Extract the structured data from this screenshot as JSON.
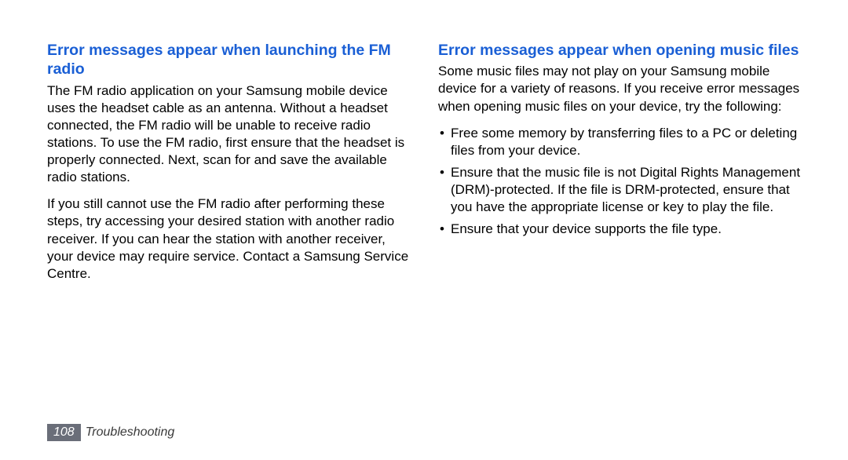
{
  "left": {
    "heading": "Error messages appear when launching the FM radio",
    "p1": "The FM radio application on your Samsung mobile device uses the headset cable as an antenna. Without a headset connected, the FM radio will be unable to receive radio stations. To use the FM radio, first ensure that the headset is properly connected. Next, scan for and save the available radio stations.",
    "p2": "If you still cannot use the FM radio after performing these steps, try accessing your desired station with another radio receiver. If you can hear the station with another receiver, your device may require service. Contact a Samsung Service Centre."
  },
  "right": {
    "heading": "Error messages appear when opening music files",
    "p1": "Some music files may not play on your Samsung mobile device for a variety of reasons. If you receive error messages when opening music files on your device, try the following:",
    "bullets": [
      "Free some memory by transferring files to a PC or deleting files from your device.",
      "Ensure that the music file is not Digital Rights Management (DRM)-protected. If the file is DRM-protected, ensure that you have the appropriate license or key to play the file.",
      "Ensure that your device supports the file type."
    ]
  },
  "footer": {
    "page_number": "108",
    "section": "Troubleshooting"
  }
}
